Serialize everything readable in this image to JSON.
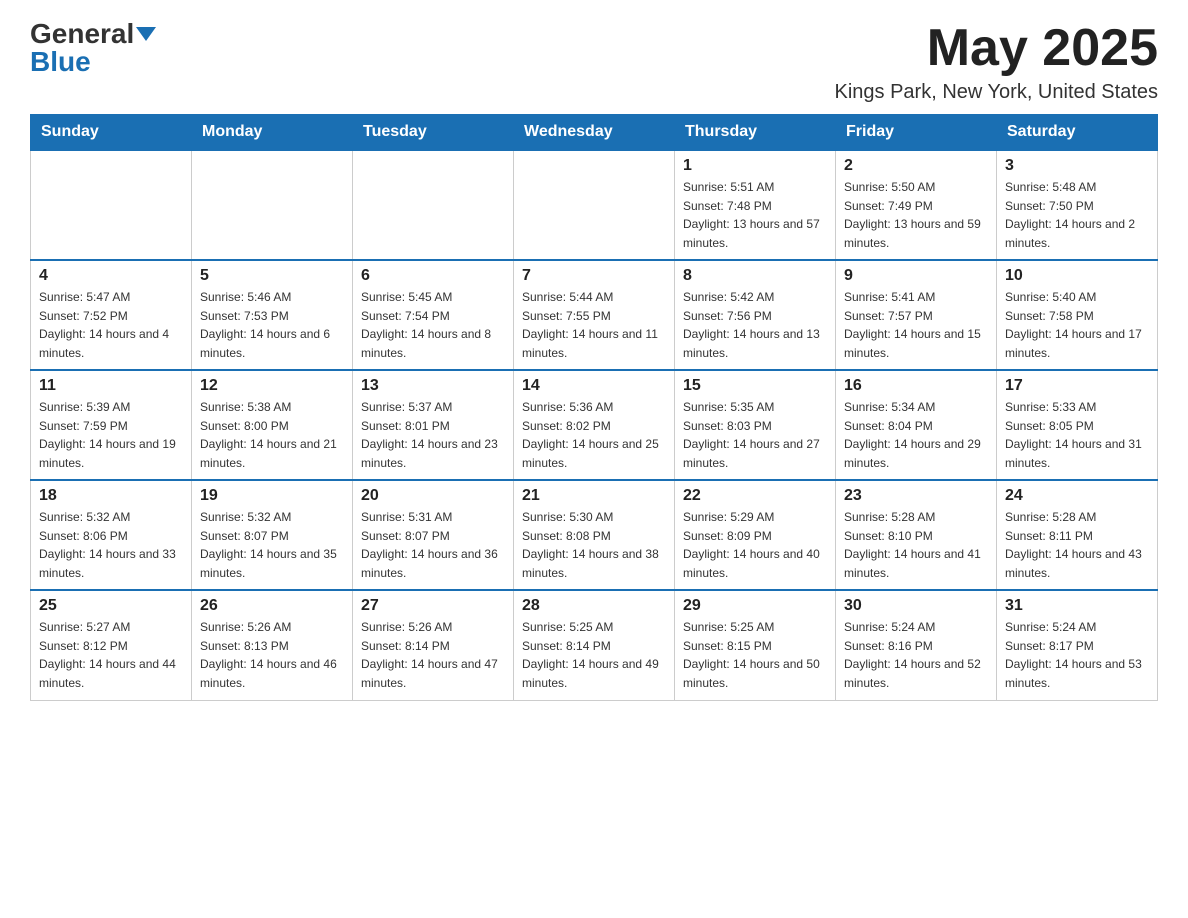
{
  "header": {
    "logo_general": "General",
    "logo_blue": "Blue",
    "month_title": "May 2025",
    "location": "Kings Park, New York, United States"
  },
  "days_of_week": [
    "Sunday",
    "Monday",
    "Tuesday",
    "Wednesday",
    "Thursday",
    "Friday",
    "Saturday"
  ],
  "weeks": [
    [
      {
        "day": "",
        "sunrise": "",
        "sunset": "",
        "daylight": ""
      },
      {
        "day": "",
        "sunrise": "",
        "sunset": "",
        "daylight": ""
      },
      {
        "day": "",
        "sunrise": "",
        "sunset": "",
        "daylight": ""
      },
      {
        "day": "",
        "sunrise": "",
        "sunset": "",
        "daylight": ""
      },
      {
        "day": "1",
        "sunrise": "Sunrise: 5:51 AM",
        "sunset": "Sunset: 7:48 PM",
        "daylight": "Daylight: 13 hours and 57 minutes."
      },
      {
        "day": "2",
        "sunrise": "Sunrise: 5:50 AM",
        "sunset": "Sunset: 7:49 PM",
        "daylight": "Daylight: 13 hours and 59 minutes."
      },
      {
        "day": "3",
        "sunrise": "Sunrise: 5:48 AM",
        "sunset": "Sunset: 7:50 PM",
        "daylight": "Daylight: 14 hours and 2 minutes."
      }
    ],
    [
      {
        "day": "4",
        "sunrise": "Sunrise: 5:47 AM",
        "sunset": "Sunset: 7:52 PM",
        "daylight": "Daylight: 14 hours and 4 minutes."
      },
      {
        "day": "5",
        "sunrise": "Sunrise: 5:46 AM",
        "sunset": "Sunset: 7:53 PM",
        "daylight": "Daylight: 14 hours and 6 minutes."
      },
      {
        "day": "6",
        "sunrise": "Sunrise: 5:45 AM",
        "sunset": "Sunset: 7:54 PM",
        "daylight": "Daylight: 14 hours and 8 minutes."
      },
      {
        "day": "7",
        "sunrise": "Sunrise: 5:44 AM",
        "sunset": "Sunset: 7:55 PM",
        "daylight": "Daylight: 14 hours and 11 minutes."
      },
      {
        "day": "8",
        "sunrise": "Sunrise: 5:42 AM",
        "sunset": "Sunset: 7:56 PM",
        "daylight": "Daylight: 14 hours and 13 minutes."
      },
      {
        "day": "9",
        "sunrise": "Sunrise: 5:41 AM",
        "sunset": "Sunset: 7:57 PM",
        "daylight": "Daylight: 14 hours and 15 minutes."
      },
      {
        "day": "10",
        "sunrise": "Sunrise: 5:40 AM",
        "sunset": "Sunset: 7:58 PM",
        "daylight": "Daylight: 14 hours and 17 minutes."
      }
    ],
    [
      {
        "day": "11",
        "sunrise": "Sunrise: 5:39 AM",
        "sunset": "Sunset: 7:59 PM",
        "daylight": "Daylight: 14 hours and 19 minutes."
      },
      {
        "day": "12",
        "sunrise": "Sunrise: 5:38 AM",
        "sunset": "Sunset: 8:00 PM",
        "daylight": "Daylight: 14 hours and 21 minutes."
      },
      {
        "day": "13",
        "sunrise": "Sunrise: 5:37 AM",
        "sunset": "Sunset: 8:01 PM",
        "daylight": "Daylight: 14 hours and 23 minutes."
      },
      {
        "day": "14",
        "sunrise": "Sunrise: 5:36 AM",
        "sunset": "Sunset: 8:02 PM",
        "daylight": "Daylight: 14 hours and 25 minutes."
      },
      {
        "day": "15",
        "sunrise": "Sunrise: 5:35 AM",
        "sunset": "Sunset: 8:03 PM",
        "daylight": "Daylight: 14 hours and 27 minutes."
      },
      {
        "day": "16",
        "sunrise": "Sunrise: 5:34 AM",
        "sunset": "Sunset: 8:04 PM",
        "daylight": "Daylight: 14 hours and 29 minutes."
      },
      {
        "day": "17",
        "sunrise": "Sunrise: 5:33 AM",
        "sunset": "Sunset: 8:05 PM",
        "daylight": "Daylight: 14 hours and 31 minutes."
      }
    ],
    [
      {
        "day": "18",
        "sunrise": "Sunrise: 5:32 AM",
        "sunset": "Sunset: 8:06 PM",
        "daylight": "Daylight: 14 hours and 33 minutes."
      },
      {
        "day": "19",
        "sunrise": "Sunrise: 5:32 AM",
        "sunset": "Sunset: 8:07 PM",
        "daylight": "Daylight: 14 hours and 35 minutes."
      },
      {
        "day": "20",
        "sunrise": "Sunrise: 5:31 AM",
        "sunset": "Sunset: 8:07 PM",
        "daylight": "Daylight: 14 hours and 36 minutes."
      },
      {
        "day": "21",
        "sunrise": "Sunrise: 5:30 AM",
        "sunset": "Sunset: 8:08 PM",
        "daylight": "Daylight: 14 hours and 38 minutes."
      },
      {
        "day": "22",
        "sunrise": "Sunrise: 5:29 AM",
        "sunset": "Sunset: 8:09 PM",
        "daylight": "Daylight: 14 hours and 40 minutes."
      },
      {
        "day": "23",
        "sunrise": "Sunrise: 5:28 AM",
        "sunset": "Sunset: 8:10 PM",
        "daylight": "Daylight: 14 hours and 41 minutes."
      },
      {
        "day": "24",
        "sunrise": "Sunrise: 5:28 AM",
        "sunset": "Sunset: 8:11 PM",
        "daylight": "Daylight: 14 hours and 43 minutes."
      }
    ],
    [
      {
        "day": "25",
        "sunrise": "Sunrise: 5:27 AM",
        "sunset": "Sunset: 8:12 PM",
        "daylight": "Daylight: 14 hours and 44 minutes."
      },
      {
        "day": "26",
        "sunrise": "Sunrise: 5:26 AM",
        "sunset": "Sunset: 8:13 PM",
        "daylight": "Daylight: 14 hours and 46 minutes."
      },
      {
        "day": "27",
        "sunrise": "Sunrise: 5:26 AM",
        "sunset": "Sunset: 8:14 PM",
        "daylight": "Daylight: 14 hours and 47 minutes."
      },
      {
        "day": "28",
        "sunrise": "Sunrise: 5:25 AM",
        "sunset": "Sunset: 8:14 PM",
        "daylight": "Daylight: 14 hours and 49 minutes."
      },
      {
        "day": "29",
        "sunrise": "Sunrise: 5:25 AM",
        "sunset": "Sunset: 8:15 PM",
        "daylight": "Daylight: 14 hours and 50 minutes."
      },
      {
        "day": "30",
        "sunrise": "Sunrise: 5:24 AM",
        "sunset": "Sunset: 8:16 PM",
        "daylight": "Daylight: 14 hours and 52 minutes."
      },
      {
        "day": "31",
        "sunrise": "Sunrise: 5:24 AM",
        "sunset": "Sunset: 8:17 PM",
        "daylight": "Daylight: 14 hours and 53 minutes."
      }
    ]
  ]
}
